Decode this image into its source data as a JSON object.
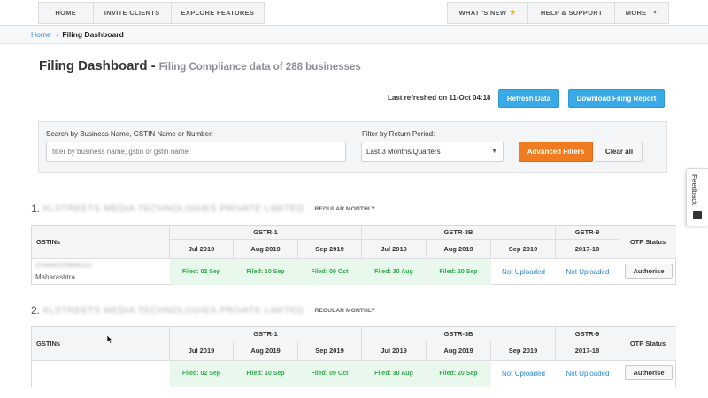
{
  "nav": {
    "left": [
      "HOME",
      "INVITE CLIENTS",
      "EXPLORE FEATURES"
    ],
    "whats_new": "WHAT 'S NEW",
    "help": "HELP & SUPPORT",
    "more": "MORE"
  },
  "breadcrumb": {
    "home": "Home",
    "separator": "›",
    "current": "Filing Dashboard"
  },
  "page": {
    "title": "Filing Dashboard -",
    "subtitle": "Filing Compliance data of 288 businesses",
    "last_refreshed": "Last refreshed on 11-Oct 04:18",
    "refresh_button": "Refresh Data",
    "download_button": "Download Filing Report"
  },
  "filters": {
    "search_label": "Search by Business Name, GSTIN Name or Number:",
    "search_placeholder": "filter by business name, gstin or gstin name",
    "period_label": "Filter by Return Period:",
    "period_value": "Last 3 Months/Quarters",
    "advanced_button": "Advanced Filters",
    "clear_button": "Clear all"
  },
  "feedback_label": "Feedback",
  "table_headers": {
    "gstins": "GSTINs",
    "gstr1": "GSTR-1",
    "gstr3b": "GSTR-3B",
    "gstr9": "GSTR-9",
    "otp": "OTP Status",
    "periods": [
      "Jul 2019",
      "Aug 2019",
      "Sep 2019",
      "Jul 2019",
      "Aug 2019",
      "Sep 2019",
      "2017-18"
    ]
  },
  "businesses": [
    {
      "number": "1.",
      "name": "XLSTREETS MEDIA TECHNOLOGIES PRIVATE LIMITED",
      "type": "REGULAR MONTHLY",
      "row": {
        "gstin": "27AAACS7892K1ZJ",
        "state": "Maharashtra",
        "status": [
          "Filed: 02 Sep",
          "Filed: 10 Sep",
          "Filed: 09 Oct",
          "Filed: 30 Aug",
          "Filed: 20 Sep",
          "Not Uploaded",
          "Not Uploaded"
        ],
        "action": "Authorise"
      }
    },
    {
      "number": "2.",
      "name": "XLSTREETS MEDIA TECHNOLOGIES PRIVATE LIMITED",
      "type": "REGULAR MONTHLY",
      "row": {
        "status": [
          "Filed: 02 Sep",
          "Filed: 10 Sep",
          "Filed: 09 Oct",
          "Filed: 30 Aug",
          "Filed: 20 Sep",
          "Not Uploaded",
          "Not Uploaded"
        ],
        "action": "Authorise"
      }
    }
  ]
}
